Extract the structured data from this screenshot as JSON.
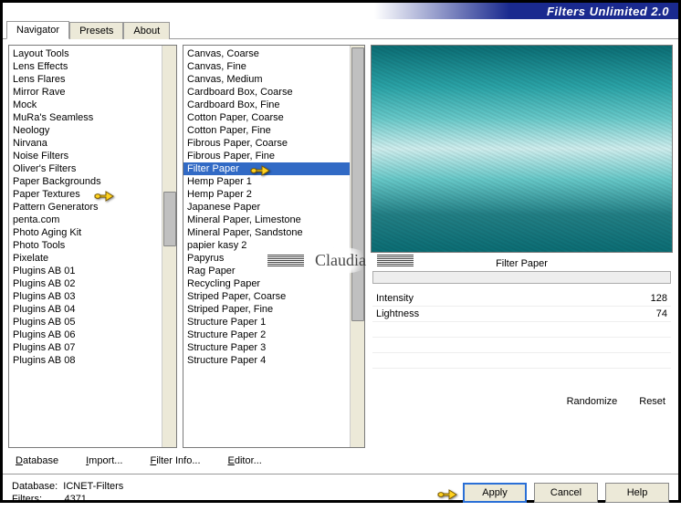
{
  "title": "Filters Unlimited 2.0",
  "tabs": [
    "Navigator",
    "Presets",
    "About"
  ],
  "active_tab": 0,
  "categories": [
    "Layout Tools",
    "Lens Effects",
    "Lens Flares",
    "Mirror Rave",
    "Mock",
    "MuRa's Seamless",
    "Neology",
    "Nirvana",
    "Noise Filters",
    "Oliver's Filters",
    "Paper Backgrounds",
    "Paper Textures",
    "Pattern Generators",
    "penta.com",
    "Photo Aging Kit",
    "Photo Tools",
    "Pixelate",
    "Plugins AB 01",
    "Plugins AB 02",
    "Plugins AB 03",
    "Plugins AB 04",
    "Plugins AB 05",
    "Plugins AB 06",
    "Plugins AB 07",
    "Plugins AB 08"
  ],
  "category_pointer_index": 11,
  "filters": [
    "Canvas, Coarse",
    "Canvas, Fine",
    "Canvas, Medium",
    "Cardboard Box, Coarse",
    "Cardboard Box, Fine",
    "Cotton Paper, Coarse",
    "Cotton Paper, Fine",
    "Fibrous Paper, Coarse",
    "Fibrous Paper, Fine",
    "Filter Paper",
    "Hemp Paper 1",
    "Hemp Paper 2",
    "Japanese Paper",
    "Mineral Paper, Limestone",
    "Mineral Paper, Sandstone",
    "papier kasy 2",
    "Papyrus",
    "Rag Paper",
    "Recycling Paper",
    "Striped Paper, Coarse",
    "Striped Paper, Fine",
    "Structure Paper 1",
    "Structure Paper 2",
    "Structure Paper 3",
    "Structure Paper 4"
  ],
  "filter_selected_index": 9,
  "current_filter": "Filter Paper",
  "params": [
    {
      "name": "Intensity",
      "value": "128"
    },
    {
      "name": "Lightness",
      "value": "74"
    }
  ],
  "right_buttons": [
    "Randomize",
    "Reset"
  ],
  "link_buttons": [
    "Database",
    "Import...",
    "Filter Info...",
    "Editor..."
  ],
  "status": {
    "db_label": "Database:",
    "db_value": "ICNET-Filters",
    "filters_label": "Filters:",
    "filters_value": "4371"
  },
  "bottom_buttons": [
    "Apply",
    "Cancel",
    "Help"
  ],
  "watermark": "Claudia"
}
